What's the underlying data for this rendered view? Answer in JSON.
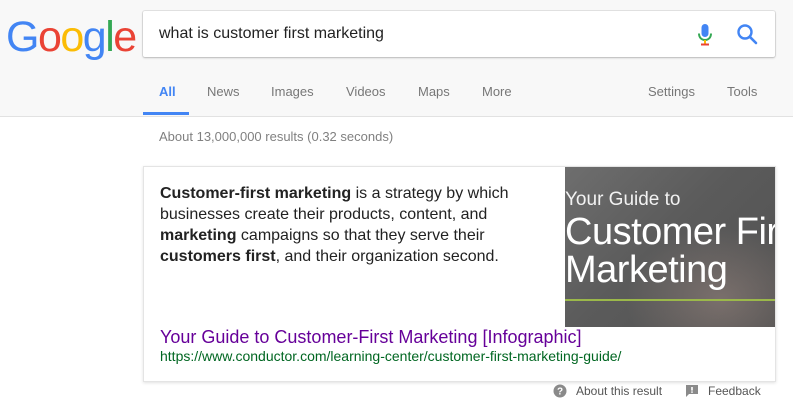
{
  "logo": {
    "letters": [
      "G",
      "o",
      "o",
      "g",
      "l",
      "e"
    ],
    "colors": [
      "#4285f4",
      "#ea4335",
      "#fbbc05",
      "#4285f4",
      "#34a853",
      "#ea4335"
    ]
  },
  "search": {
    "query": "what is customer first marketing",
    "mic_icon": "mic-icon",
    "search_icon": "search-icon"
  },
  "tabs": [
    {
      "label": "All",
      "active": true
    },
    {
      "label": "News"
    },
    {
      "label": "Images"
    },
    {
      "label": "Videos"
    },
    {
      "label": "Maps"
    },
    {
      "label": "More"
    },
    {
      "label": "Settings"
    },
    {
      "label": "Tools"
    }
  ],
  "result_stats": "About 13,000,000 results (0.32 seconds)",
  "featured_snippet": {
    "segments": [
      {
        "text": "Customer-first marketing",
        "bold": true
      },
      {
        "text": " is a strategy by which businesses create their products, content, and ",
        "bold": false
      },
      {
        "text": "marketing",
        "bold": true
      },
      {
        "text": " campaigns so that they serve their ",
        "bold": false
      },
      {
        "text": "customers first",
        "bold": true
      },
      {
        "text": ", and their organization second.",
        "bold": false
      }
    ],
    "image_text": {
      "line1": "Your Guide to",
      "line2": "Customer First",
      "line3": "Marketing"
    },
    "title": "Your Guide to Customer-First Marketing [Infographic]",
    "url": "https://www.conductor.com/learning-center/customer-first-marketing-guide/"
  },
  "footer": {
    "about": "About this result",
    "feedback": "Feedback"
  },
  "colors": {
    "accent": "#4285f4",
    "visited_link": "#660099",
    "url_green": "#006621"
  }
}
